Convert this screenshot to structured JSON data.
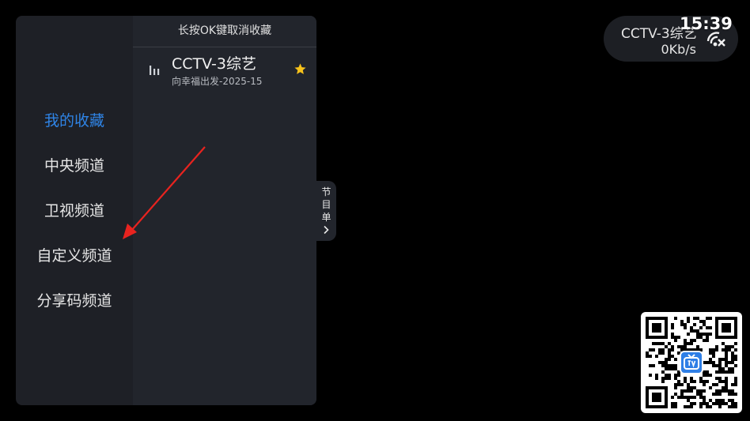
{
  "panel": {
    "header": "长按OK键取消收藏",
    "categories": [
      {
        "label": "我的收藏",
        "active": true
      },
      {
        "label": "中央频道",
        "active": false
      },
      {
        "label": "卫视频道",
        "active": false
      },
      {
        "label": "自定义频道",
        "active": false
      },
      {
        "label": "分享码频道",
        "active": false
      }
    ],
    "channels": [
      {
        "name": "CCTV-3综艺",
        "program": "向幸福出发-2025-15",
        "favorite": true
      }
    ]
  },
  "epg_tab": {
    "chars": [
      "节",
      "目",
      "单"
    ],
    "icon": "chevron-right-icon"
  },
  "status": {
    "channel": "CCTV-3综艺",
    "speed": "0Kb/s",
    "time": "15:39",
    "icon": "network-signal-icon"
  },
  "qr": {
    "logo_icon": "tv-logo-icon"
  },
  "colors": {
    "accent": "#2f84e6",
    "favorite_star": "#f7c21b",
    "annotation_arrow": "#e8231f"
  }
}
